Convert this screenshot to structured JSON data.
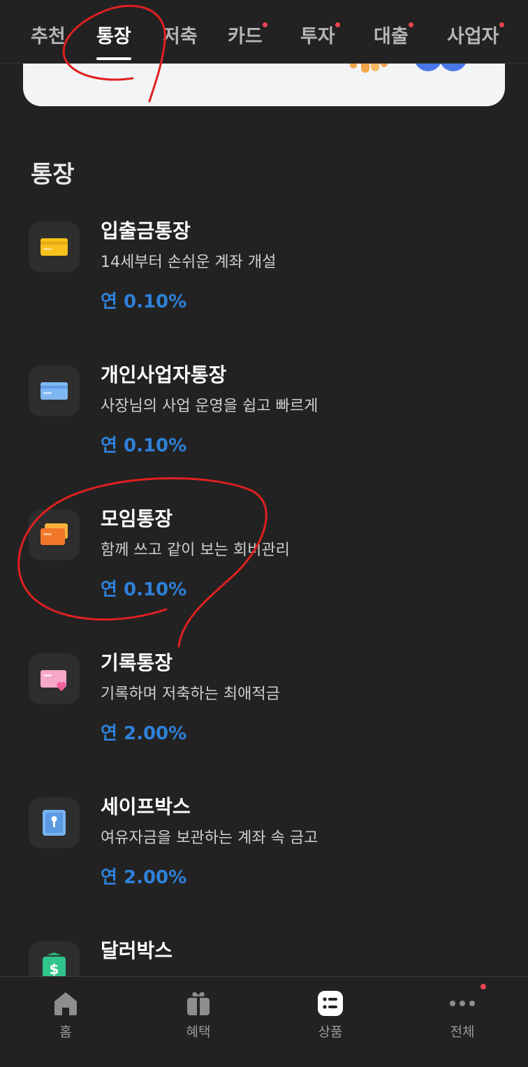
{
  "colors": {
    "background": "#222222",
    "rate_blue": "#2f80d8",
    "notification_red": "#f04452",
    "annotation_red": "#e02020"
  },
  "top_tabs": [
    {
      "label": "추천",
      "active": false,
      "dot": false
    },
    {
      "label": "통장",
      "active": true,
      "dot": false
    },
    {
      "label": "저축",
      "active": false,
      "dot": false
    },
    {
      "label": "카드",
      "active": false,
      "dot": true
    },
    {
      "label": "투자",
      "active": false,
      "dot": true
    },
    {
      "label": "대출",
      "active": false,
      "dot": true
    },
    {
      "label": "사업자",
      "active": false,
      "dot": true
    }
  ],
  "section": {
    "title": "통장"
  },
  "products": [
    {
      "icon": "yellow-card-icon",
      "title": "입출금통장",
      "description": "14세부터 손쉬운 계좌 개설",
      "rate": "연 0.10%"
    },
    {
      "icon": "blue-card-icon",
      "title": "개인사업자통장",
      "description": "사장님의 사업 운영을 쉽고 빠르게",
      "rate": "연 0.10%"
    },
    {
      "icon": "orange-cards-icon",
      "title": "모임통장",
      "description": "함께 쓰고 같이 보는 회비관리",
      "rate": "연 0.10%"
    },
    {
      "icon": "pink-heart-card-icon",
      "title": "기록통장",
      "description": "기록하며 저축하는 최애적금",
      "rate": "연 2.00%"
    },
    {
      "icon": "safebox-icon",
      "title": "세이프박스",
      "description": "여유자금을 보관하는 계좌 속 금고",
      "rate": "연 2.00%"
    },
    {
      "icon": "dollar-box-icon",
      "title": "달러박스",
      "description": "",
      "rate": ""
    }
  ],
  "bottom_nav": [
    {
      "icon": "home-icon",
      "label": "홈",
      "active": false
    },
    {
      "icon": "gift-icon",
      "label": "혜택",
      "active": false
    },
    {
      "icon": "list-icon",
      "label": "상품",
      "active": true
    },
    {
      "icon": "more-dots-icon",
      "label": "전체",
      "active": false,
      "dot": true
    }
  ]
}
